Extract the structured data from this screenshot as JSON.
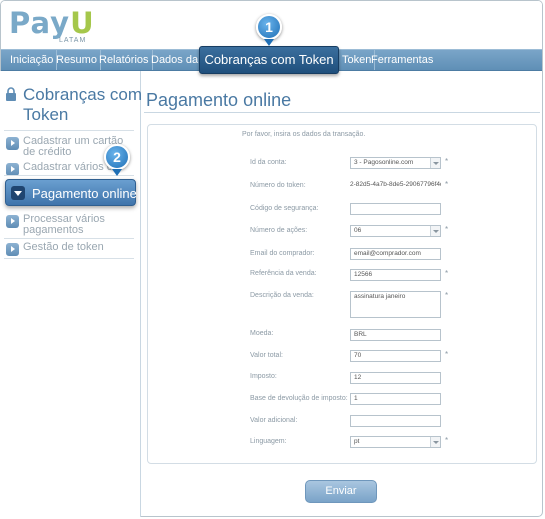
{
  "logo": {
    "main_a": "Pay",
    "main_b": "U",
    "sub": "LATAM"
  },
  "nav": {
    "items": [
      "Iniciação",
      "Resumo",
      "Relatórios",
      "Dados da Loja",
      "",
      "Token",
      "Ferramentas"
    ],
    "highlight": "Cobranças com Token"
  },
  "badges": {
    "one": "1",
    "two": "2"
  },
  "sidebar": {
    "title": "Cobranças com Token",
    "items": [
      "Cadastrar um cartão de crédito",
      "Cadastrar vários cartões",
      "Pagamento online",
      "Processar vários pagamentos",
      "Gestão de token"
    ]
  },
  "main": {
    "title": "Pagamento online",
    "intro": "Por favor, insira os dados da transação.",
    "fields": [
      {
        "label": "Id da conta:",
        "value": "3 - Pagosonline.com",
        "required": "*"
      },
      {
        "label": "Número do token:",
        "value": "2-82d5-4a7b-8de5-29067796f4da",
        "required": "*"
      },
      {
        "label": "Código de segurança:",
        "value": ""
      },
      {
        "label": "Número de ações:",
        "value": "06",
        "required": "*"
      },
      {
        "label": "Email do comprador:",
        "value": "email@comprador.com"
      },
      {
        "label": "Referência da venda:",
        "value": "12566",
        "required": "*"
      },
      {
        "label": "Descrição da venda:",
        "value": "assinatura janeiro",
        "required": "*"
      },
      {
        "label": "Moeda:",
        "value": "BRL"
      },
      {
        "label": "Valor total:",
        "value": "70",
        "required": "*"
      },
      {
        "label": "Imposto:",
        "value": "12"
      },
      {
        "label": "Base de devolução de imposto:",
        "value": "1"
      },
      {
        "label": "Valor adicional:",
        "value": ""
      },
      {
        "label": "Linguagem:",
        "value": "pt",
        "required": "*"
      }
    ],
    "submit": "Enviar"
  },
  "colors": {
    "nav": "#6b98bf",
    "accent": "#4a79a3",
    "badge": "#1f6fb5",
    "logo_green": "#a5c74b"
  }
}
